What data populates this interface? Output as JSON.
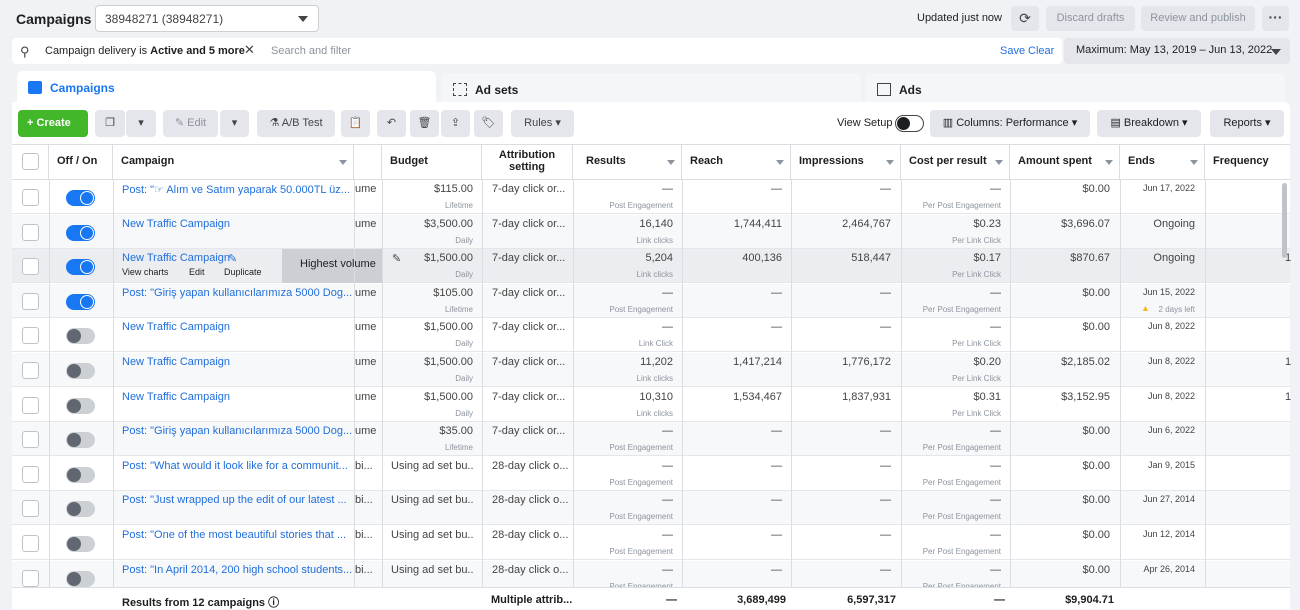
{
  "header": {
    "title": "Campaigns",
    "account": "38948271 (38948271)",
    "updated": "Updated just now",
    "discard": "Discard drafts",
    "review": "Review and publish",
    "more": "···"
  },
  "filter": {
    "chip_prefix": "Campaign delivery is ",
    "chip_bold": "Active and 5 more",
    "placeholder": "Search and filter",
    "save": "Save",
    "clear": "Clear",
    "date_range": "Maximum: May 13, 2019 – Jun 13, 2022"
  },
  "tabs": [
    {
      "label": "Campaigns"
    },
    {
      "label": "Ad sets"
    },
    {
      "label": "Ads"
    }
  ],
  "toolbar": {
    "create": "Create",
    "edit": "Edit",
    "ab_test": "A/B Test",
    "rules": "Rules",
    "view_setup": "View Setup",
    "columns": "Columns: Performance",
    "breakdown": "Breakdown",
    "reports": "Reports"
  },
  "columns": {
    "onoff": "Off / On",
    "campaign": "Campaign",
    "budget": "Budget",
    "attribution": "Attribution setting",
    "results": "Results",
    "reach": "Reach",
    "impressions": "Impressions",
    "cpr": "Cost per result",
    "spent": "Amount spent",
    "ends": "Ends",
    "frequency": "Frequency"
  },
  "hover_row": {
    "view_charts": "View charts",
    "edit": "Edit",
    "duplicate": "Duplicate",
    "bid": "Highest volume"
  },
  "rows": [
    {
      "on": true,
      "name": "Post: \"☞ Alım ve Satım yaparak 50.000TL üz...",
      "bid": "ume",
      "budget": "$115.00",
      "budget_type": "Lifetime",
      "attr": "7-day click or...",
      "results": "—",
      "results_type": "Post Engagement",
      "reach": "—",
      "impr": "—",
      "cpr": "—",
      "cpr_type": "Per Post Engagement",
      "spent": "$0.00",
      "ends": "Jun 17, 2022",
      "ends_note": ""
    },
    {
      "on": true,
      "name": "New Traffic Campaign",
      "bid": "ume",
      "budget": "$3,500.00",
      "budget_type": "Daily",
      "attr": "7-day click or...",
      "results": "16,140",
      "results_type": "Link clicks",
      "reach": "1,744,411",
      "impr": "2,464,767",
      "cpr": "$0.23",
      "cpr_type": "Per Link Click",
      "spent": "$3,696.07",
      "ends": "Ongoing",
      "ends_note": ""
    },
    {
      "on": true,
      "name": "New Traffic Campaign",
      "bid": "",
      "budget": "$1,500.00",
      "budget_type": "Daily",
      "attr": "7-day click or...",
      "results": "5,204",
      "results_type": "Link clicks",
      "reach": "400,136",
      "impr": "518,447",
      "cpr": "$0.17",
      "cpr_type": "Per Link Click",
      "spent": "$870.67",
      "ends": "Ongoing",
      "ends_note": ""
    },
    {
      "on": true,
      "name": "Post: \"Giriş yapan kullanıcılarımıza 5000 Dog...",
      "bid": "ume",
      "budget": "$105.00",
      "budget_type": "Lifetime",
      "attr": "7-day click or...",
      "results": "—",
      "results_type": "Post Engagement",
      "reach": "—",
      "impr": "—",
      "cpr": "—",
      "cpr_type": "Per Post Engagement",
      "spent": "$0.00",
      "ends": "Jun 15, 2022",
      "ends_note": "2 days left"
    },
    {
      "on": false,
      "name": "New Traffic Campaign",
      "bid": "ume",
      "budget": "$1,500.00",
      "budget_type": "Daily",
      "attr": "7-day click or...",
      "results": "—",
      "results_type": "Link Click",
      "reach": "—",
      "impr": "—",
      "cpr": "—",
      "cpr_type": "Per Link Click",
      "spent": "$0.00",
      "ends": "Jun 8, 2022",
      "ends_note": ""
    },
    {
      "on": false,
      "name": "New Traffic Campaign",
      "bid": "ume",
      "budget": "$1,500.00",
      "budget_type": "Daily",
      "attr": "7-day click or...",
      "results": "11,202",
      "results_type": "Link clicks",
      "reach": "1,417,214",
      "impr": "1,776,172",
      "cpr": "$0.20",
      "cpr_type": "Per Link Click",
      "spent": "$2,185.02",
      "ends": "Jun 8, 2022",
      "ends_note": ""
    },
    {
      "on": false,
      "name": "New Traffic Campaign",
      "bid": "ume",
      "budget": "$1,500.00",
      "budget_type": "Daily",
      "attr": "7-day click or...",
      "results": "10,310",
      "results_type": "Link clicks",
      "reach": "1,534,467",
      "impr": "1,837,931",
      "cpr": "$0.31",
      "cpr_type": "Per Link Click",
      "spent": "$3,152.95",
      "ends": "Jun 8, 2022",
      "ends_note": ""
    },
    {
      "on": false,
      "name": "Post: \"Giriş yapan kullanıcılarımıza 5000 Dog...",
      "bid": "ume",
      "budget": "$35.00",
      "budget_type": "Lifetime",
      "attr": "7-day click or...",
      "results": "—",
      "results_type": "Post Engagement",
      "reach": "—",
      "impr": "—",
      "cpr": "—",
      "cpr_type": "Per Post Engagement",
      "spent": "$0.00",
      "ends": "Jun 6, 2022",
      "ends_note": ""
    },
    {
      "on": false,
      "name": "Post: \"What would it look like for a communit...",
      "bid": "bi...",
      "budget": "Using ad set bu...",
      "budget_type": "",
      "attr": "28-day click o...",
      "results": "—",
      "results_type": "Post Engagement",
      "reach": "—",
      "impr": "—",
      "cpr": "—",
      "cpr_type": "Per Post Engagement",
      "spent": "$0.00",
      "ends": "Jan 9, 2015",
      "ends_note": ""
    },
    {
      "on": false,
      "name": "Post: \"Just wrapped up the edit of our latest ...",
      "bid": "bi...",
      "budget": "Using ad set bu...",
      "budget_type": "",
      "attr": "28-day click o...",
      "results": "—",
      "results_type": "Post Engagement",
      "reach": "—",
      "impr": "—",
      "cpr": "—",
      "cpr_type": "Per Post Engagement",
      "spent": "$0.00",
      "ends": "Jun 27, 2014",
      "ends_note": ""
    },
    {
      "on": false,
      "name": "Post: \"One of the most beautiful stories that ...",
      "bid": "bi...",
      "budget": "Using ad set bu...",
      "budget_type": "",
      "attr": "28-day click o...",
      "results": "—",
      "results_type": "Post Engagement",
      "reach": "—",
      "impr": "—",
      "cpr": "—",
      "cpr_type": "Per Post Engagement",
      "spent": "$0.00",
      "ends": "Jun 12, 2014",
      "ends_note": ""
    },
    {
      "on": false,
      "name": "Post: \"In April 2014, 200 high school students...",
      "bid": "bi...",
      "budget": "Using ad set bu...",
      "budget_type": "",
      "attr": "28-day click o...",
      "results": "—",
      "results_type": "Post Engagement",
      "reach": "—",
      "impr": "—",
      "cpr": "—",
      "cpr_type": "Per Post Engagement",
      "spent": "$0.00",
      "ends": "Apr 26, 2014",
      "ends_note": ""
    }
  ],
  "footer": {
    "label": "Results from 12 campaigns",
    "attr": "Multiple attrib...",
    "results": "—",
    "reach": "3,689,499",
    "impr": "6,597,317",
    "cpr": "—",
    "spent": "$9,904.71"
  },
  "partial_frequency_values": [
    "1",
    "1",
    "1"
  ],
  "colors": {
    "accent": "#1877f2",
    "create": "#42b72a",
    "link": "#216fdb"
  }
}
